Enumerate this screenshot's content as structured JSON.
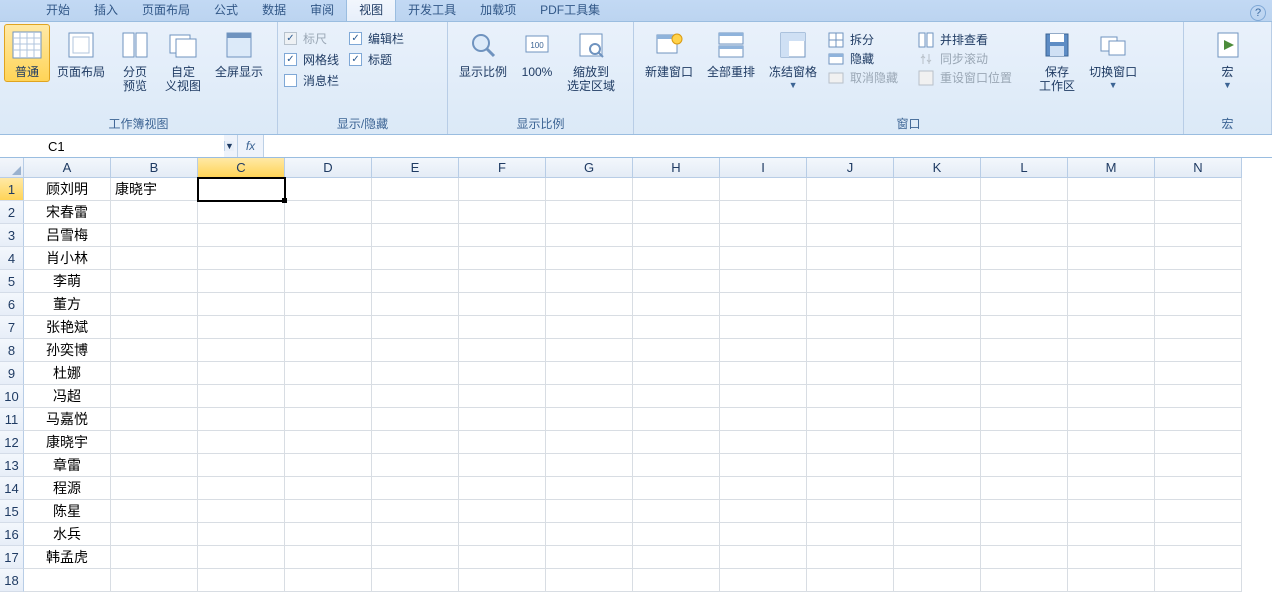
{
  "tabs": [
    "开始",
    "插入",
    "页面布局",
    "公式",
    "数据",
    "审阅",
    "视图",
    "开发工具",
    "加载项",
    "PDF工具集"
  ],
  "active_tab_index": 6,
  "ribbon": {
    "view_group_label": "工作簿视图",
    "view_btns": {
      "normal": "普通",
      "page_layout": "页面布局",
      "page_break": "分页\n预览",
      "custom": "自定\n义视图",
      "full": "全屏显示"
    },
    "show_group_label": "显示/隐藏",
    "show_checks": {
      "ruler": "标尺",
      "formula_bar": "编辑栏",
      "gridlines": "网格线",
      "headings": "标题",
      "message_bar": "消息栏"
    },
    "zoom_group_label": "显示比例",
    "zoom_btns": {
      "zoom": "显示比例",
      "hundred": "100%",
      "to_sel": "缩放到\n选定区域"
    },
    "window_group_label": "窗口",
    "window_btns": {
      "new_win": "新建窗口",
      "arrange": "全部重排",
      "freeze": "冻结窗格"
    },
    "window_mini": {
      "split": "拆分",
      "hide": "隐藏",
      "unhide": "取消隐藏",
      "side_by_side": "并排查看",
      "sync_scroll": "同步滚动",
      "reset_pos": "重设窗口位置"
    },
    "window_btns2": {
      "save_ws": "保存\n工作区",
      "switch": "切换窗口"
    },
    "macro_group_label": "宏",
    "macro_btn": "宏"
  },
  "namebox_value": "C1",
  "formula_value": "",
  "columns": [
    "A",
    "B",
    "C",
    "D",
    "E",
    "F",
    "G",
    "H",
    "I",
    "J",
    "K",
    "L",
    "M",
    "N"
  ],
  "selected_col_index": 2,
  "selected_row_index": 0,
  "row_count": 18,
  "col_a": [
    "顾刘明",
    "宋春雷",
    "吕雪梅",
    "肖小林",
    "李萌",
    "董方",
    "张艳斌",
    "孙奕博",
    "杜娜",
    "冯超",
    "马嘉悦",
    "康晓宇",
    "章雷",
    "程源",
    "陈星",
    "水兵",
    "韩孟虎",
    ""
  ],
  "b1": "康晓宇"
}
